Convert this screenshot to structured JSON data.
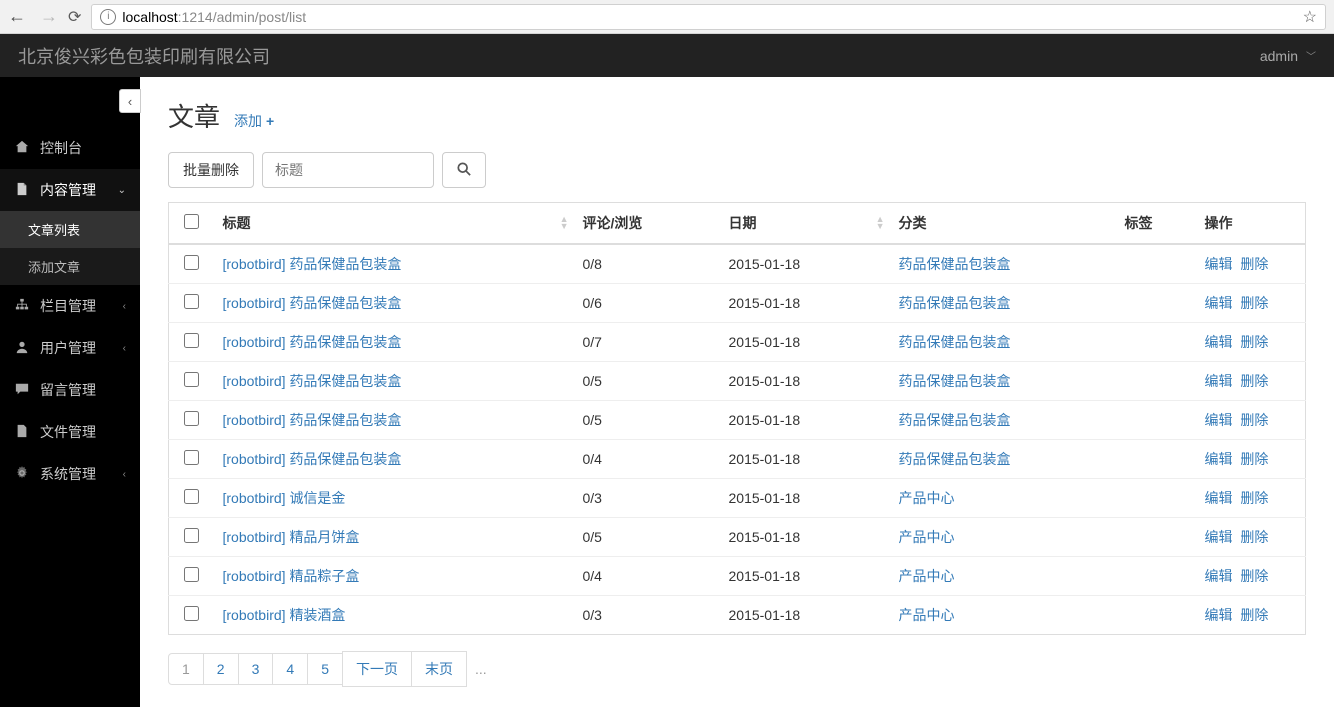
{
  "browser": {
    "url_host": "localhost",
    "url_path": ":1214/admin/post/list"
  },
  "header": {
    "brand": "北京俊兴彩色包装印刷有限公司",
    "user": "admin"
  },
  "sidebar": {
    "items": [
      {
        "icon": "dashboard",
        "label": "控制台",
        "expandable": false
      },
      {
        "icon": "file",
        "label": "内容管理",
        "expandable": true,
        "expanded": true,
        "children": [
          {
            "label": "文章列表",
            "active": true
          },
          {
            "label": "添加文章",
            "active": false
          }
        ]
      },
      {
        "icon": "sitemap",
        "label": "栏目管理",
        "expandable": true
      },
      {
        "icon": "user",
        "label": "用户管理",
        "expandable": true
      },
      {
        "icon": "comment",
        "label": "留言管理",
        "expandable": false
      },
      {
        "icon": "file2",
        "label": "文件管理",
        "expandable": false
      },
      {
        "icon": "gear",
        "label": "系统管理",
        "expandable": true
      }
    ]
  },
  "page": {
    "title": "文章",
    "add_label": "添加",
    "bulk_delete": "批量删除",
    "search_placeholder": "标题"
  },
  "table": {
    "columns": {
      "title": "标题",
      "stats": "评论/浏览",
      "date": "日期",
      "category": "分类",
      "tag": "标签",
      "ops": "操作"
    },
    "ops": {
      "edit": "编辑",
      "delete": "删除"
    },
    "rows": [
      {
        "author": "[robotbird]",
        "title": "药品保健品包装盒",
        "stats": "0/8",
        "date": "2015-01-18",
        "category": "药品保健品包装盒"
      },
      {
        "author": "[robotbird]",
        "title": "药品保健品包装盒",
        "stats": "0/6",
        "date": "2015-01-18",
        "category": "药品保健品包装盒"
      },
      {
        "author": "[robotbird]",
        "title": "药品保健品包装盒",
        "stats": "0/7",
        "date": "2015-01-18",
        "category": "药品保健品包装盒"
      },
      {
        "author": "[robotbird]",
        "title": "药品保健品包装盒",
        "stats": "0/5",
        "date": "2015-01-18",
        "category": "药品保健品包装盒"
      },
      {
        "author": "[robotbird]",
        "title": "药品保健品包装盒",
        "stats": "0/5",
        "date": "2015-01-18",
        "category": "药品保健品包装盒"
      },
      {
        "author": "[robotbird]",
        "title": "药品保健品包装盒",
        "stats": "0/4",
        "date": "2015-01-18",
        "category": "药品保健品包装盒"
      },
      {
        "author": "[robotbird]",
        "title": "诚信是金",
        "stats": "0/3",
        "date": "2015-01-18",
        "category": "产品中心"
      },
      {
        "author": "[robotbird]",
        "title": "精品月饼盒",
        "stats": "0/5",
        "date": "2015-01-18",
        "category": "产品中心"
      },
      {
        "author": "[robotbird]",
        "title": "精品粽子盒",
        "stats": "0/4",
        "date": "2015-01-18",
        "category": "产品中心"
      },
      {
        "author": "[robotbird]",
        "title": "精装酒盒",
        "stats": "0/3",
        "date": "2015-01-18",
        "category": "产品中心"
      }
    ]
  },
  "pagination": {
    "pages": [
      "1",
      "2",
      "3",
      "4",
      "5"
    ],
    "current": "1",
    "next": "下一页",
    "last": "末页",
    "more": "..."
  },
  "icons": {
    "dashboard": "▣",
    "file": "📄",
    "sitemap": "⛬",
    "user": "👤",
    "comment": "💬",
    "file2": "📄",
    "gear": "⚙"
  }
}
